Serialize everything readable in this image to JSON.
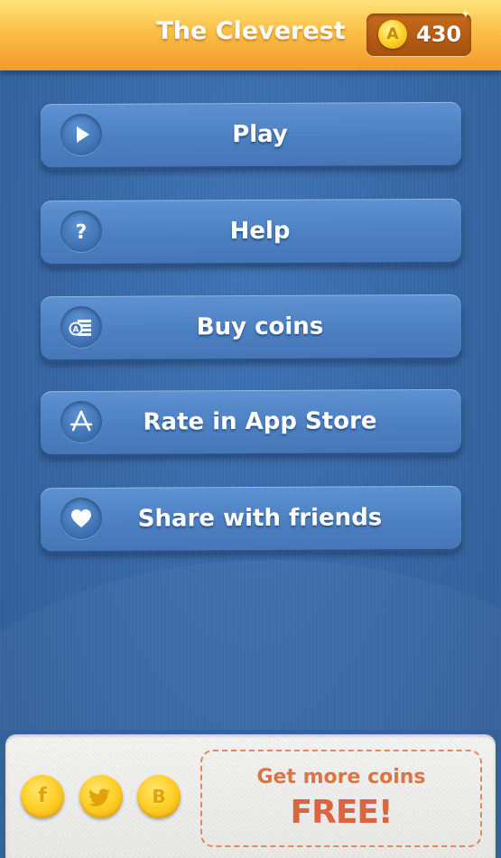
{
  "header": {
    "title": "The Cleverest",
    "coin_symbol": "A",
    "coins": "430"
  },
  "menu": {
    "items": [
      {
        "label": "Play",
        "icon": "play-icon"
      },
      {
        "label": "Help",
        "icon": "question-icon"
      },
      {
        "label": "Buy coins",
        "icon": "coins-stack-icon"
      },
      {
        "label": "Rate in App Store",
        "icon": "app-store-icon"
      },
      {
        "label": "Share with friends",
        "icon": "heart-icon"
      }
    ]
  },
  "footer": {
    "social": [
      {
        "glyph": "f",
        "icon": "facebook-icon"
      },
      {
        "glyph": "",
        "icon": "twitter-icon"
      },
      {
        "glyph": "B",
        "icon": "vk-icon"
      }
    ],
    "promo_line1": "Get more coins",
    "promo_line2": "FREE!"
  },
  "colors": {
    "header_top": "#fde37a",
    "header_bottom": "#f29a2a",
    "background": "#3566a4",
    "button": "#4c80c2",
    "coin": "#ffcc1e",
    "promo_text": "#d9703f"
  }
}
